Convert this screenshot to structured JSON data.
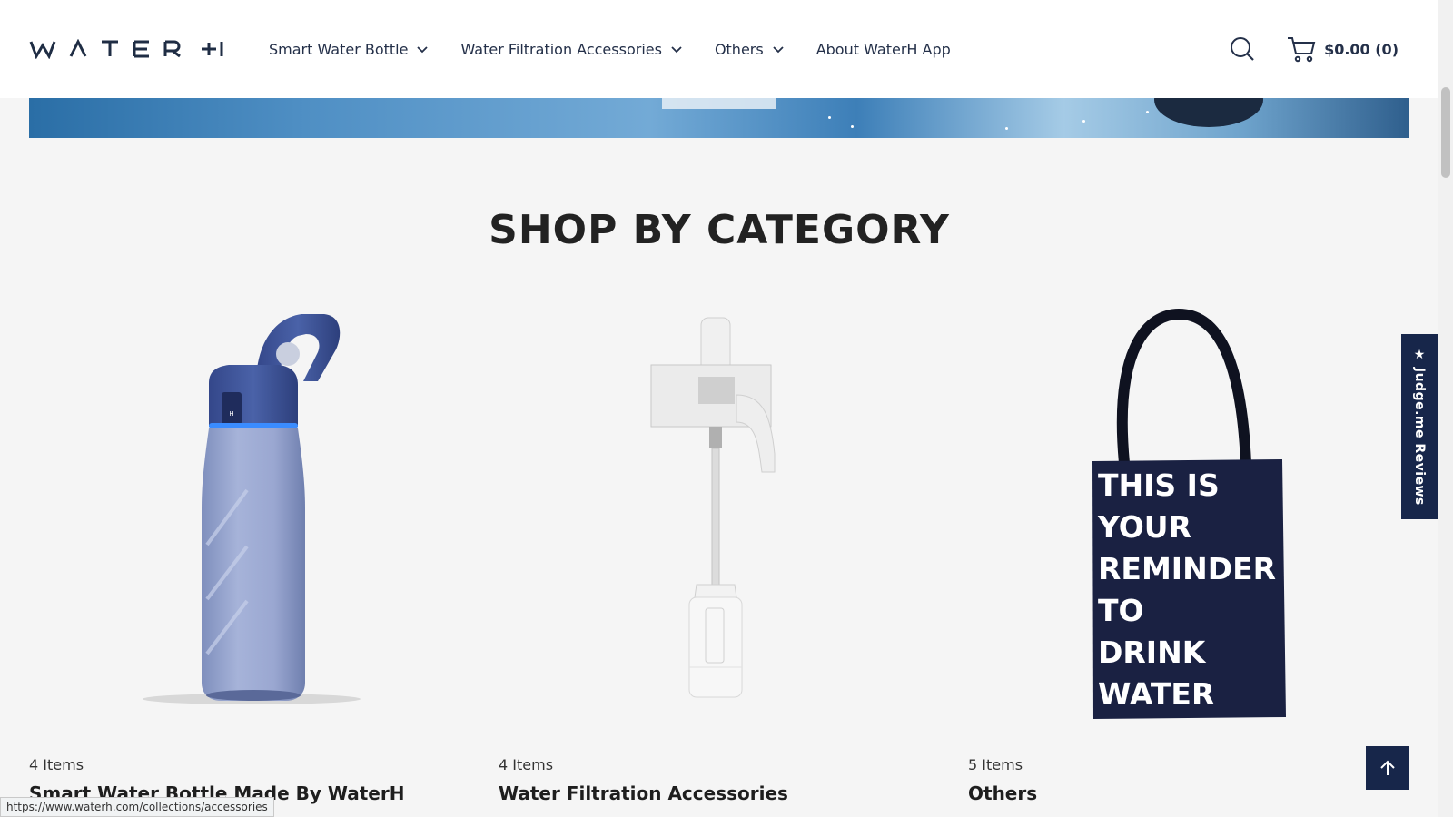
{
  "header": {
    "logo": "WATER H",
    "nav": [
      {
        "label": "Smart Water Bottle",
        "has_dropdown": true
      },
      {
        "label": "Water Filtration Accessories",
        "has_dropdown": true
      },
      {
        "label": "Others",
        "has_dropdown": true
      },
      {
        "label": "About WaterH App",
        "has_dropdown": false
      }
    ],
    "cart_total": "$0.00 (0)"
  },
  "section": {
    "title": "SHOP BY CATEGORY",
    "categories": [
      {
        "count": "4 Items",
        "name": "Smart Water Bottle Made By WaterH"
      },
      {
        "count": "4 Items",
        "name": "Water Filtration Accessories"
      },
      {
        "count": "5 Items",
        "name": "Others"
      }
    ]
  },
  "tote_lines": [
    "THIS IS",
    "YOUR",
    "REMINDER",
    "TO",
    "DRINK",
    "WATER"
  ],
  "widgets": {
    "judge_label": "★ Judge.me Reviews"
  },
  "status_url": "https://www.waterh.com/collections/accessories",
  "colors": {
    "brand_navy": "#17264a",
    "nav_text": "#243049",
    "page_bg": "#f5f5f5"
  }
}
